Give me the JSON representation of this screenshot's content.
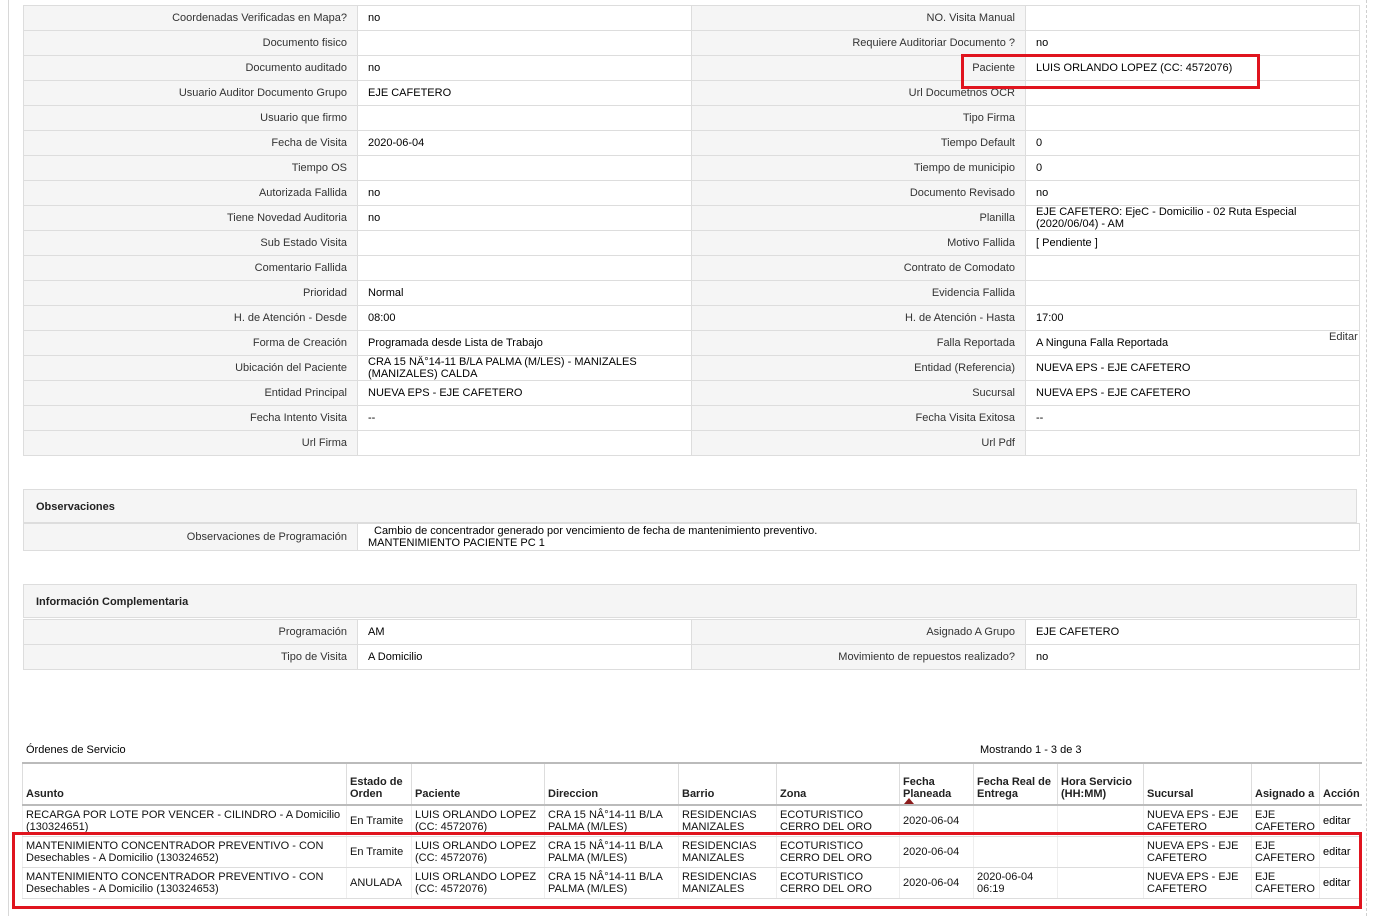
{
  "detail_rows": [
    {
      "l1": "Coordenadas Verificadas en Mapa?",
      "v1": "no",
      "l2": "NO. Visita Manual",
      "v2": ""
    },
    {
      "l1": "Documento fisico",
      "v1": "",
      "l2": "Requiere Auditoriar Documento ?",
      "v2": "no"
    },
    {
      "l1": "Documento auditado",
      "v1": "no",
      "l2": "Paciente",
      "v2": "LUIS ORLANDO LOPEZ (CC: 4572076)"
    },
    {
      "l1": "Usuario Auditor Documento Grupo",
      "v1": "EJE CAFETERO",
      "l2": "Url Documetnos OCR",
      "v2": ""
    },
    {
      "l1": "Usuario que firmo",
      "v1": "",
      "l2": "Tipo Firma",
      "v2": ""
    },
    {
      "l1": "Fecha de Visita",
      "v1": "2020-06-04",
      "l2": "Tiempo Default",
      "v2": "0"
    },
    {
      "l1": "Tiempo OS",
      "v1": "",
      "l2": "Tiempo de municipio",
      "v2": "0"
    },
    {
      "l1": "Autorizada Fallida",
      "v1": "no",
      "l2": "Documento Revisado",
      "v2": "no"
    },
    {
      "l1": "Tiene Novedad Auditoria",
      "v1": "no",
      "l2": "Planilla",
      "v2": "EJE CAFETERO: EjeC - Domicilio - 02 Ruta Especial (2020/06/04) - AM"
    },
    {
      "l1": "Sub Estado Visita",
      "v1": "",
      "l2": "Motivo Fallida",
      "v2": "[ Pendiente ]"
    },
    {
      "l1": "Comentario Fallida",
      "v1": "",
      "l2": "Contrato de Comodato",
      "v2": ""
    },
    {
      "l1": "Prioridad",
      "v1": "Normal",
      "l2": "Evidencia Fallida",
      "v2": ""
    },
    {
      "l1": "H. de Atención - Desde",
      "v1": "08:00",
      "l2": "H. de Atención - Hasta",
      "v2": "17:00"
    },
    {
      "l1": "Forma de Creación",
      "v1": "Programada desde Lista de Trabajo",
      "l2": "Falla Reportada",
      "v2": "A Ninguna Falla Reportada"
    },
    {
      "l1": "Ubicación del Paciente",
      "v1": "CRA 15 NÂ°14-11 B/LA PALMA (M/LES) - MANIZALES (MANIZALES) CALDA",
      "l2": "Entidad (Referencia)",
      "v2": "NUEVA EPS - EJE CAFETERO"
    },
    {
      "l1": "Entidad Principal",
      "v1": "NUEVA EPS - EJE CAFETERO",
      "l2": "Sucursal",
      "v2": "NUEVA EPS - EJE CAFETERO"
    },
    {
      "l1": "Fecha Intento Visita",
      "v1": "--",
      "l2": "Fecha Visita Exitosa",
      "v2": "--"
    },
    {
      "l1": "Url Firma",
      "v1": "",
      "l2": "Url Pdf",
      "v2": ""
    }
  ],
  "editar_label": "Editar",
  "observaciones": {
    "title": "Observaciones",
    "label": "Observaciones de Programación",
    "line1": "Cambio de concentrador generado por vencimiento de fecha de mantenimiento preventivo.",
    "line2": "MANTENIMIENTO PACIENTE PC 1"
  },
  "complementaria": {
    "title": "Información Complementaria",
    "rows": [
      {
        "l1": "Programación",
        "v1": "AM",
        "l2": "Asignado A Grupo",
        "v2": "EJE CAFETERO"
      },
      {
        "l1": "Tipo de Visita",
        "v1": "A Domicilio",
        "l2": "Movimiento de repuestos realizado?",
        "v2": "no"
      }
    ]
  },
  "orders": {
    "title": "Órdenes de Servicio",
    "count": "Mostrando 1 - 3 de 3",
    "headers": [
      "Asunto",
      "Estado de Orden",
      "Paciente",
      "Direccion",
      "Barrio",
      "Zona",
      "Fecha Planeada",
      "Fecha Real de Entrega",
      "Hora Servicio (HH:MM)",
      "Sucursal",
      "Asignado a",
      "Acción"
    ],
    "rows": [
      [
        "RECARGA POR LOTE POR VENCER - CILINDRO - A Domicilio (130324651)",
        "En Tramite",
        "LUIS ORLANDO LOPEZ (CC: 4572076)",
        "CRA 15 NÂ°14-11 B/LA PALMA (M/LES)",
        "RESIDENCIAS MANIZALES",
        "ECOTURISTICO CERRO DEL ORO",
        "2020-06-04",
        "",
        "",
        "NUEVA EPS - EJE CAFETERO",
        "EJE CAFETERO",
        "editar"
      ],
      [
        "MANTENIMIENTO CONCENTRADOR PREVENTIVO - CON Desechables - A Domicilio (130324652)",
        "En Tramite",
        "LUIS ORLANDO LOPEZ (CC: 4572076)",
        "CRA 15 NÂ°14-11 B/LA PALMA (M/LES)",
        "RESIDENCIAS MANIZALES",
        "ECOTURISTICO CERRO DEL ORO",
        "2020-06-04",
        "",
        "",
        "NUEVA EPS - EJE CAFETERO",
        "EJE CAFETERO",
        "editar"
      ],
      [
        "MANTENIMIENTO CONCENTRADOR PREVENTIVO - CON Desechables - A Domicilio (130324653)",
        "ANULADA",
        "LUIS ORLANDO LOPEZ (CC: 4572076)",
        "CRA 15 NÂ°14-11 B/LA PALMA (M/LES)",
        "RESIDENCIAS MANIZALES",
        "ECOTURISTICO CERRO DEL ORO",
        "2020-06-04",
        "2020-06-04 06:19",
        "",
        "NUEVA EPS - EJE CAFETERO",
        "EJE CAFETERO",
        "editar"
      ]
    ]
  },
  "colors": {
    "highlight": "#e0141e",
    "label_bg": "#f5f5f5",
    "border": "#dddddd"
  }
}
